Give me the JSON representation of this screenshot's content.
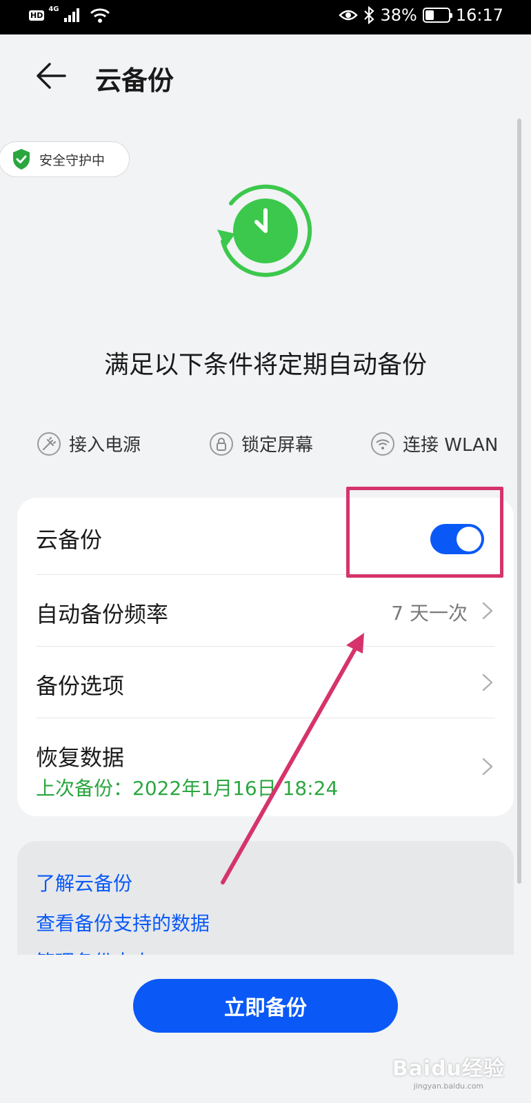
{
  "status_bar": {
    "network_badge": "HD",
    "network_type": "4G",
    "battery_percent": "38%",
    "battery_level": 0.38,
    "time": "16:17"
  },
  "header": {
    "title": "云备份"
  },
  "security": {
    "label": "安全守护中"
  },
  "conditions": {
    "title": "满足以下条件将定期自动备份",
    "items": [
      {
        "label": "接入电源",
        "icon": "plug-icon"
      },
      {
        "label": "锁定屏幕",
        "icon": "lock-icon"
      },
      {
        "label": "连接 WLAN",
        "icon": "wifi-icon"
      }
    ]
  },
  "settings": {
    "cloud_backup_label": "云备份",
    "cloud_backup_enabled": true,
    "frequency_label": "自动备份频率",
    "frequency_value": "7 天一次",
    "options_label": "备份选项",
    "restore_label": "恢复数据",
    "last_backup": "上次备份：2022年1月16日 18:24"
  },
  "links": {
    "learn": "了解云备份",
    "supported_data": "查看备份支持的数据",
    "manage": "管理备份大小"
  },
  "actions": {
    "backup_now": "立即备份"
  },
  "watermark": {
    "main": "Baidu经验",
    "sub": "jingyan.baidu.com"
  },
  "colors": {
    "accent": "#0a59f7",
    "success_green": "#2aa63f",
    "highlight": "#d6336c",
    "clock_green": "#3cc84c"
  }
}
